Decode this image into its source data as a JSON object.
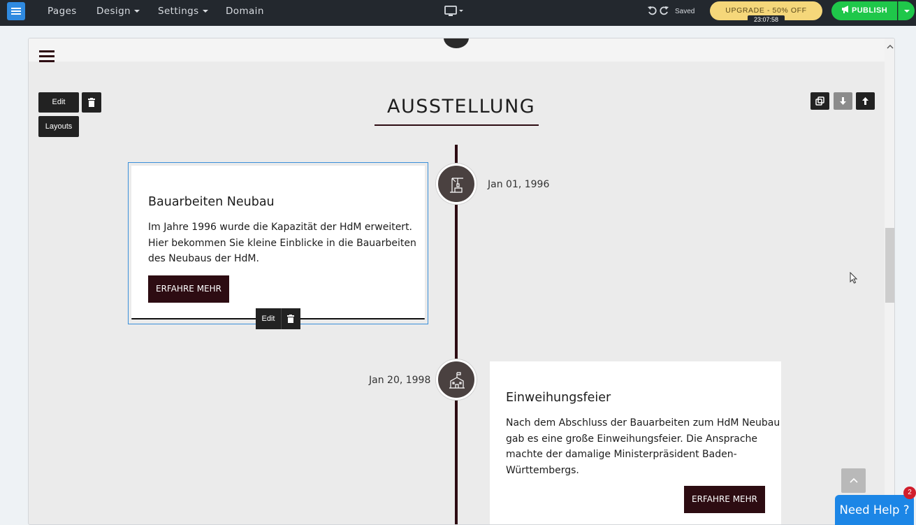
{
  "topbar": {
    "nav": [
      "Pages",
      "Design",
      "Settings",
      "Domain"
    ],
    "saved": "Saved",
    "upgrade": "UPGRADE - 50% OFF",
    "timer": "23:07:58",
    "publish": "PUBLISH"
  },
  "toolbar": {
    "edit": "Edit",
    "layouts": "Layouts",
    "item_edit": "Edit"
  },
  "section": {
    "title": "AUSSTELLUNG"
  },
  "timeline": [
    {
      "date": "Jan 01, 1996",
      "title": "Bauarbeiten Neubau",
      "lines": [
        "Im Jahre 1996 wurde die Kapazität der HdM erweitert.",
        "Hier bekommen Sie kleine Einblicke in die Bauarbeiten",
        "des Neubaus der HdM."
      ],
      "button": "ERFAHRE MEHR",
      "icon": "crane-icon"
    },
    {
      "date": "Jan 20, 1998",
      "title": "Einweihungsfeier",
      "lines": [
        "Nach dem Abschluss der Bauarbeiten zum HdM Neubau",
        "gab es eine große Einweihungsfeier. Die Ansprache",
        "machte der damalige Ministerpräsident Baden-",
        "Württembergs."
      ],
      "button": "ERFAHRE MEHR",
      "icon": "school-building-icon"
    }
  ],
  "help": {
    "label": "Need Help ?",
    "badge": "2"
  }
}
